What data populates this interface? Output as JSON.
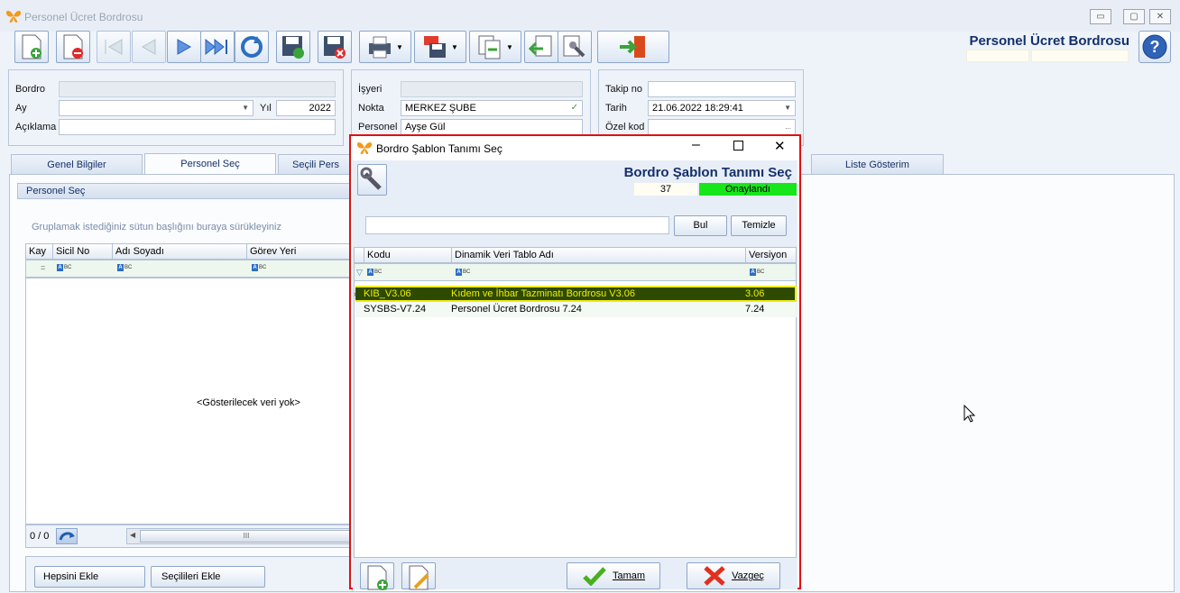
{
  "window": {
    "title": "Personel Ücret Bordrosu",
    "min": "▭",
    "max": "▢",
    "close": "✕"
  },
  "header": {
    "title": "Personel Ücret Bordrosu"
  },
  "form1": {
    "bordro_label": "Bordro",
    "ay_label": "Ay",
    "yil_label": "Yıl",
    "yil_value": "2022",
    "aciklama_label": "Açıklama"
  },
  "form2": {
    "isyeri_label": "İşyeri",
    "nokta_label": "Nokta",
    "nokta_value": "MERKEZ ŞUBE",
    "personel_label": "Personel",
    "personel_value": "Ayşe Gül"
  },
  "form3": {
    "takip_label": "Takip no",
    "tarih_label": "Tarih",
    "tarih_value": "21.06.2022 18:29:41",
    "ozel_label": "Özel kod",
    "ozel_btn": "..."
  },
  "tabs": [
    "Genel Bilgiler",
    "Personel Seç",
    "Seçili Pers",
    "Liste Gösterim"
  ],
  "personel_panel": {
    "title": "Personel Seç",
    "group_hint": "Gruplamak istediğiniz sütun başlığını buraya sürükleyiniz",
    "columns": [
      "Kay",
      "Sicil No",
      "Adı Soyadı",
      "Görev Yeri"
    ],
    "empty": "<Gösterilecek veri yok>",
    "counter": "0 / 0",
    "scroll_grip": "III",
    "add_all": "Hepsini Ekle",
    "add_selected": "Seçilileri Ekle"
  },
  "dialog": {
    "title": "Bordro Şablon Tanımı Seç",
    "heading": "Bordro Şablon Tanımı Seç",
    "count": "37",
    "status": "Onaylandı",
    "search_btn": "Bul",
    "clear_btn": "Temizle",
    "columns": [
      "Kodu",
      "Dinamik Veri Tablo Adı",
      "Versiyon"
    ],
    "rows": [
      {
        "code": "KIB_V3.06",
        "name": "Kıdem ve İhbar Tazminatı Bordrosu V3.06",
        "version": "3.06"
      },
      {
        "code": "SYSBS-V7.24",
        "name": "Personel Ücret Bordrosu 7.24",
        "version": "7.24"
      }
    ],
    "ok": "Tamam",
    "cancel": "Vazgeç"
  },
  "colors": {
    "accent": "#14306a",
    "selected_row": "#2d4a00",
    "selected_text": "#f2ee00",
    "status_green": "#17e61b",
    "highlight_border": "#e01010"
  }
}
